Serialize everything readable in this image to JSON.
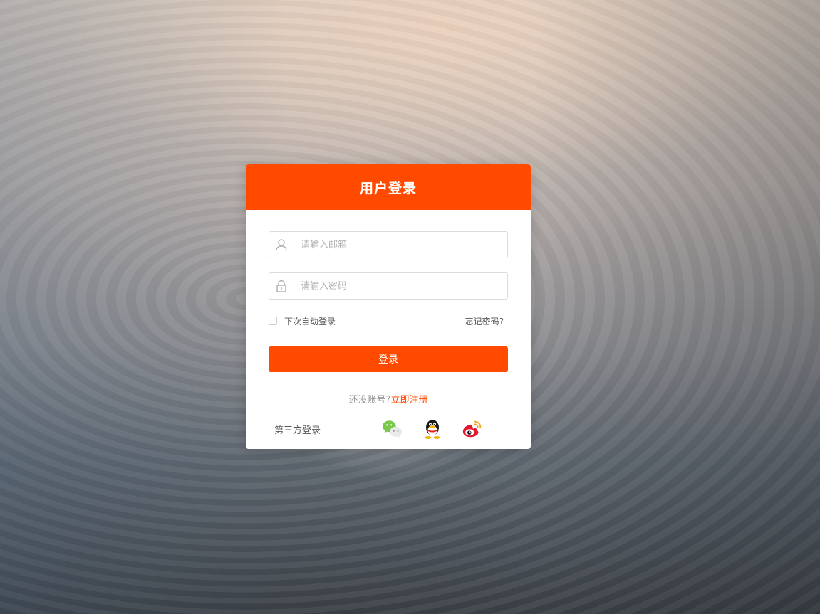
{
  "header": {
    "title": "用户登录"
  },
  "form": {
    "email": {
      "placeholder": "请输入邮箱",
      "value": ""
    },
    "password": {
      "placeholder": "请输入密码",
      "value": ""
    },
    "remember_label": "下次自动登录",
    "forgot_label": "忘记密码?",
    "login_label": "登录",
    "no_account_text": "还没账号?",
    "register_link": "立即注册"
  },
  "third_party": {
    "label": "第三方登录",
    "providers": [
      "wechat-icon",
      "qq-icon",
      "weibo-icon"
    ]
  },
  "colors": {
    "accent": "#ff4a00"
  }
}
